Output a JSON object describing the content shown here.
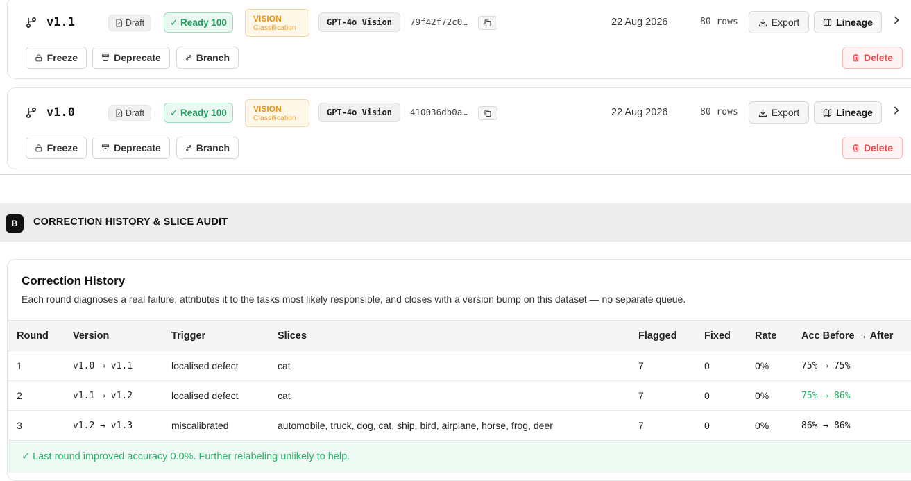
{
  "versions": [
    {
      "name": "v1.1",
      "status": "Draft",
      "ready": "✓ Ready 100",
      "modality": "VISION",
      "task": "Classification",
      "model": "GPT-4o Vision",
      "hash": "79f42f72c0…",
      "date": "22 Aug 2026",
      "rows": "80 rows",
      "export_label": "Export",
      "lineage_label": "Lineage",
      "freeze_label": "Freeze",
      "deprecate_label": "Deprecate",
      "branch_label": "Branch",
      "delete_label": "Delete"
    },
    {
      "name": "v1.0",
      "status": "Draft",
      "ready": "✓ Ready 100",
      "modality": "VISION",
      "task": "Classification",
      "model": "GPT-4o Vision",
      "hash": "410036db0a…",
      "date": "22 Aug 2026",
      "rows": "80 rows",
      "export_label": "Export",
      "lineage_label": "Lineage",
      "freeze_label": "Freeze",
      "deprecate_label": "Deprecate",
      "branch_label": "Branch",
      "delete_label": "Delete"
    }
  ],
  "section_b": {
    "badge": "B",
    "title": "CORRECTION HISTORY & SLICE AUDIT"
  },
  "correction_history": {
    "title": "Correction History",
    "description": "Each round diagnoses a real failure, attributes it to the tasks most likely responsible, and closes with a version bump on this dataset — no separate queue.",
    "columns": [
      "Round",
      "Version",
      "Trigger",
      "Slices",
      "Flagged",
      "Fixed",
      "Rate",
      "Acc Before → After"
    ],
    "rows": [
      [
        "1",
        "v1.0 → v1.1",
        "localised defect",
        "cat",
        "7",
        "0",
        "0%",
        "75% → 75%"
      ],
      [
        "2",
        "v1.1 → v1.2",
        "localised defect",
        "cat",
        "7",
        "0",
        "0%",
        "75% → 86%"
      ],
      [
        "3",
        "v1.2 → v1.3",
        "miscalibrated",
        "automobile, truck, dog, cat, ship, bird, airplane, horse, frog, deer",
        "7",
        "0",
        "0%",
        "86% → 86%"
      ]
    ],
    "footnote": "✓ Last round improved accuracy 0.0%. Further relabeling unlikely to help."
  },
  "colors": {
    "ready_green": "#1f9d5b",
    "vision_orange": "#e69411",
    "delete_red": "#e5484d",
    "improve_green": "#2db36b"
  }
}
